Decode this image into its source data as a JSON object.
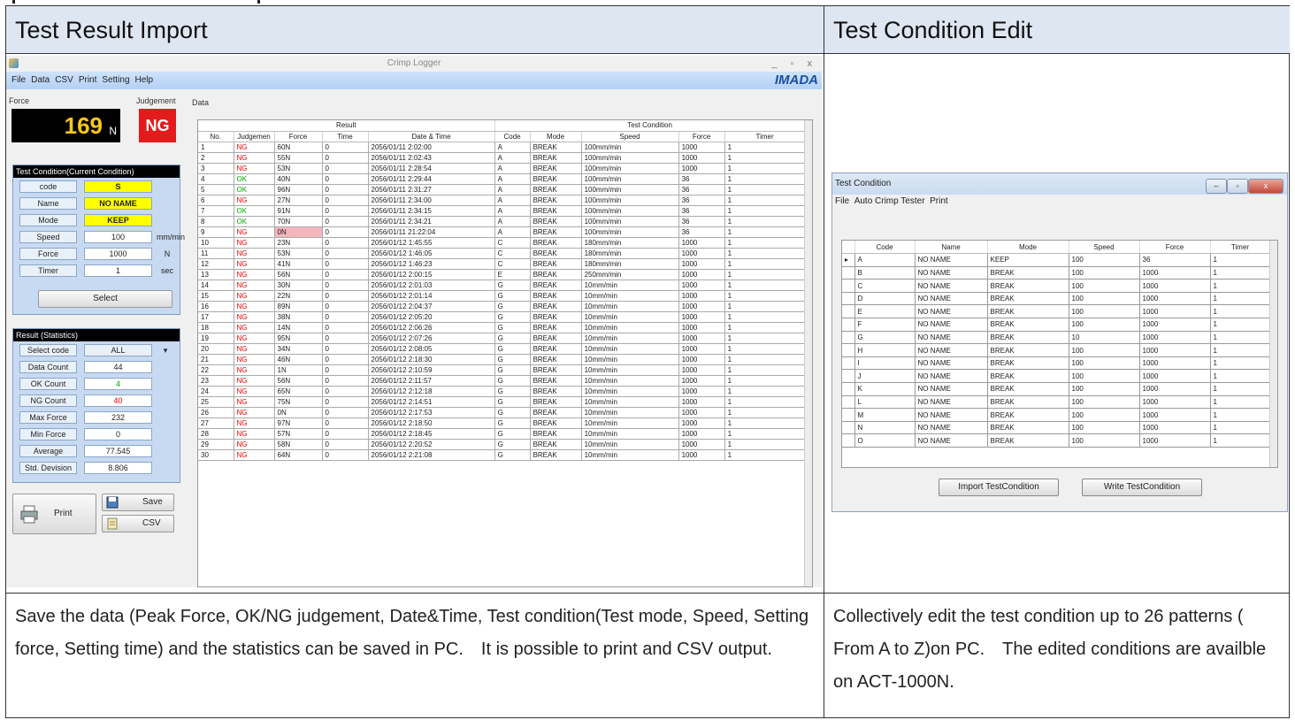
{
  "headers": {
    "left": "Test Result Import",
    "right": "Test Condition Edit"
  },
  "descriptions": {
    "left": "Save the data (Peak Force, OK/NG judgement, Date&Time, Test condition(Test mode, Speed, Setting force, Setting time) and the statistics can be saved in PC.　It is possible to print and CSV output.",
    "right": "Collectively edit the test condition up to 26 patterns ( From A to Z)on PC.　The edited conditions are availble on ACT-1000N."
  },
  "logger": {
    "title": "Crimp Logger",
    "window_controls": "_ ▫ x",
    "menu": [
      "File",
      "Data",
      "CSV",
      "Print",
      "Setting",
      "Help"
    ],
    "brand": "IMADA",
    "force_label": "Force",
    "judgement_label": "Judgement",
    "data_label": "Data",
    "force_value": "169",
    "force_unit": "N",
    "judgement_value": "NG",
    "test_condition": {
      "title": "Test Condition(Current Condition)",
      "rows": [
        {
          "label": "code",
          "value": "S",
          "unit": ""
        },
        {
          "label": "Name",
          "value": "NO NAME",
          "unit": ""
        },
        {
          "label": "Mode",
          "value": "KEEP",
          "unit": ""
        },
        {
          "label": "Speed",
          "value": "100",
          "unit": "mm/min"
        },
        {
          "label": "Force",
          "value": "1000",
          "unit": "N"
        },
        {
          "label": "Timer",
          "value": "1",
          "unit": "sec"
        }
      ],
      "select_button": "Select"
    },
    "statistics": {
      "title": "Result (Statistics)",
      "rows": [
        {
          "label": "Select code",
          "value": "ALL"
        },
        {
          "label": "Data Count",
          "value": "44"
        },
        {
          "label": "OK Count",
          "value": "4"
        },
        {
          "label": "NG Count",
          "value": "40"
        },
        {
          "label": "Max Force",
          "value": "232"
        },
        {
          "label": "Min Force",
          "value": "0"
        },
        {
          "label": "Average",
          "value": "77.545"
        },
        {
          "label": "Std. Devision",
          "value": "8.806"
        }
      ]
    },
    "buttons": {
      "print": "Print",
      "save": "Save",
      "csv": "CSV"
    },
    "table": {
      "group_headers": [
        "Result",
        "Test Condition"
      ],
      "columns": [
        "No.",
        "Judgemen",
        "Force",
        "Time",
        "Date & Time",
        "Code",
        "Mode",
        "Speed",
        "Force",
        "Timer"
      ],
      "rows": [
        [
          "1",
          "NG",
          "60N",
          "0",
          "2056/01/11 2:02:00",
          "A",
          "BREAK",
          "100mm/min",
          "1000",
          "1"
        ],
        [
          "2",
          "NG",
          "55N",
          "0",
          "2056/01/11 2:02:43",
          "A",
          "BREAK",
          "100mm/min",
          "1000",
          "1"
        ],
        [
          "3",
          "NG",
          "53N",
          "0",
          "2056/01/11 2:28:54",
          "A",
          "BREAK",
          "100mm/min",
          "1000",
          "1"
        ],
        [
          "4",
          "OK",
          "40N",
          "0",
          "2056/01/11 2:29:44",
          "A",
          "BREAK",
          "100mm/min",
          "36",
          "1"
        ],
        [
          "5",
          "OK",
          "96N",
          "0",
          "2056/01/11 2:31:27",
          "A",
          "BREAK",
          "100mm/min",
          "36",
          "1"
        ],
        [
          "6",
          "NG",
          "27N",
          "0",
          "2056/01/11 2:34:00",
          "A",
          "BREAK",
          "100mm/min",
          "36",
          "1"
        ],
        [
          "7",
          "OK",
          "91N",
          "0",
          "2056/01/11 2:34:15",
          "A",
          "BREAK",
          "100mm/min",
          "36",
          "1"
        ],
        [
          "8",
          "OK",
          "70N",
          "0",
          "2056/01/11 2:34:21",
          "A",
          "BREAK",
          "100mm/min",
          "36",
          "1"
        ],
        [
          "9",
          "NG",
          "0N",
          "0",
          "2056/01/11 21:22:04",
          "A",
          "BREAK",
          "100mm/min",
          "36",
          "1"
        ],
        [
          "10",
          "NG",
          "23N",
          "0",
          "2056/01/12 1:45:55",
          "C",
          "BREAK",
          "180mm/min",
          "1000",
          "1"
        ],
        [
          "11",
          "NG",
          "53N",
          "0",
          "2056/01/12 1:46:05",
          "C",
          "BREAK",
          "180mm/min",
          "1000",
          "1"
        ],
        [
          "12",
          "NG",
          "41N",
          "0",
          "2056/01/12 1:46:23",
          "C",
          "BREAK",
          "180mm/min",
          "1000",
          "1"
        ],
        [
          "13",
          "NG",
          "56N",
          "0",
          "2056/01/12 2:00:15",
          "E",
          "BREAK",
          "250mm/min",
          "1000",
          "1"
        ],
        [
          "14",
          "NG",
          "30N",
          "0",
          "2056/01/12 2:01:03",
          "G",
          "BREAK",
          "10mm/min",
          "1000",
          "1"
        ],
        [
          "15",
          "NG",
          "22N",
          "0",
          "2056/01/12 2:01:14",
          "G",
          "BREAK",
          "10mm/min",
          "1000",
          "1"
        ],
        [
          "16",
          "NG",
          "89N",
          "0",
          "2056/01/12 2:04:37",
          "G",
          "BREAK",
          "10mm/min",
          "1000",
          "1"
        ],
        [
          "17",
          "NG",
          "38N",
          "0",
          "2056/01/12 2:05:20",
          "G",
          "BREAK",
          "10mm/min",
          "1000",
          "1"
        ],
        [
          "18",
          "NG",
          "14N",
          "0",
          "2056/01/12 2:06:26",
          "G",
          "BREAK",
          "10mm/min",
          "1000",
          "1"
        ],
        [
          "19",
          "NG",
          "95N",
          "0",
          "2056/01/12 2:07:26",
          "G",
          "BREAK",
          "10mm/min",
          "1000",
          "1"
        ],
        [
          "20",
          "NG",
          "34N",
          "0",
          "2056/01/12 2:08:05",
          "G",
          "BREAK",
          "10mm/min",
          "1000",
          "1"
        ],
        [
          "21",
          "NG",
          "46N",
          "0",
          "2056/01/12 2:18:30",
          "G",
          "BREAK",
          "10mm/min",
          "1000",
          "1"
        ],
        [
          "22",
          "NG",
          "1N",
          "0",
          "2056/01/12 2:10:59",
          "G",
          "BREAK",
          "10mm/min",
          "1000",
          "1"
        ],
        [
          "23",
          "NG",
          "56N",
          "0",
          "2056/01/12 2:11:57",
          "G",
          "BREAK",
          "10mm/min",
          "1000",
          "1"
        ],
        [
          "24",
          "NG",
          "65N",
          "0",
          "2056/01/12 2:12:18",
          "G",
          "BREAK",
          "10mm/min",
          "1000",
          "1"
        ],
        [
          "25",
          "NG",
          "75N",
          "0",
          "2056/01/12 2:14:51",
          "G",
          "BREAK",
          "10mm/min",
          "1000",
          "1"
        ],
        [
          "26",
          "NG",
          "0N",
          "0",
          "2056/01/12 2:17:53",
          "G",
          "BREAK",
          "10mm/min",
          "1000",
          "1"
        ],
        [
          "27",
          "NG",
          "97N",
          "0",
          "2056/01/12 2:18:50",
          "G",
          "BREAK",
          "10mm/min",
          "1000",
          "1"
        ],
        [
          "28",
          "NG",
          "57N",
          "0",
          "2056/01/12 2:18:45",
          "G",
          "BREAK",
          "10mm/min",
          "1000",
          "1"
        ],
        [
          "29",
          "NG",
          "58N",
          "0",
          "2056/01/12 2:20:52",
          "G",
          "BREAK",
          "10mm/min",
          "1000",
          "1"
        ],
        [
          "30",
          "NG",
          "64N",
          "0",
          "2056/01/12 2:21:08",
          "G",
          "BREAK",
          "10mm/min",
          "1000",
          "1"
        ]
      ]
    }
  },
  "condition_editor": {
    "title": "Test Condition",
    "menu": [
      "File",
      "Auto Crimp Tester",
      "Print"
    ],
    "columns": [
      "Code",
      "Name",
      "Mode",
      "Speed",
      "Force",
      "Timer"
    ],
    "rows": [
      [
        "A",
        "NO NAME",
        "KEEP",
        "100",
        "36",
        "1"
      ],
      [
        "B",
        "NO NAME",
        "BREAK",
        "100",
        "1000",
        "1"
      ],
      [
        "C",
        "NO NAME",
        "BREAK",
        "100",
        "1000",
        "1"
      ],
      [
        "D",
        "NO NAME",
        "BREAK",
        "100",
        "1000",
        "1"
      ],
      [
        "E",
        "NO NAME",
        "BREAK",
        "100",
        "1000",
        "1"
      ],
      [
        "F",
        "NO NAME",
        "BREAK",
        "100",
        "1000",
        "1"
      ],
      [
        "G",
        "NO NAME",
        "BREAK",
        "10",
        "1000",
        "1"
      ],
      [
        "H",
        "NO NAME",
        "BREAK",
        "100",
        "1000",
        "1"
      ],
      [
        "I",
        "NO NAME",
        "BREAK",
        "100",
        "1000",
        "1"
      ],
      [
        "J",
        "NO NAME",
        "BREAK",
        "100",
        "1000",
        "1"
      ],
      [
        "K",
        "NO NAME",
        "BREAK",
        "100",
        "1000",
        "1"
      ],
      [
        "L",
        "NO NAME",
        "BREAK",
        "100",
        "1000",
        "1"
      ],
      [
        "M",
        "NO NAME",
        "BREAK",
        "100",
        "1000",
        "1"
      ],
      [
        "N",
        "NO NAME",
        "BREAK",
        "100",
        "1000",
        "1"
      ],
      [
        "O",
        "NO NAME",
        "BREAK",
        "100",
        "1000",
        "1"
      ]
    ],
    "import_button": "Import TestCondition",
    "write_button": "Write TestCondition"
  }
}
